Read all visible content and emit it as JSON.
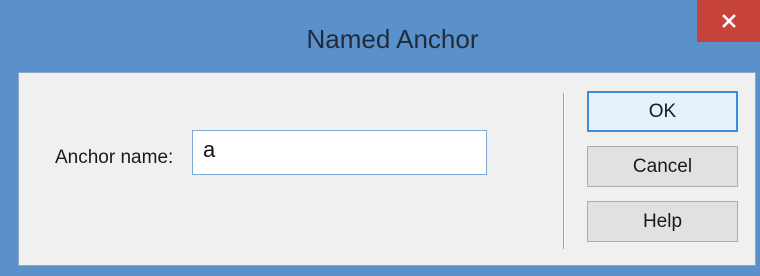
{
  "window": {
    "title": "Named Anchor",
    "close_glyph": "×"
  },
  "form": {
    "anchor_label": "Anchor name:",
    "anchor_value": "a"
  },
  "buttons": {
    "ok": "OK",
    "cancel": "Cancel",
    "help": "Help"
  },
  "icons": {
    "close": "close-icon"
  },
  "colors": {
    "titlebar": "#5b91cb",
    "close_button": "#c7433a",
    "client_bg": "#f0f0f0",
    "default_button_border": "#3b8ede"
  }
}
